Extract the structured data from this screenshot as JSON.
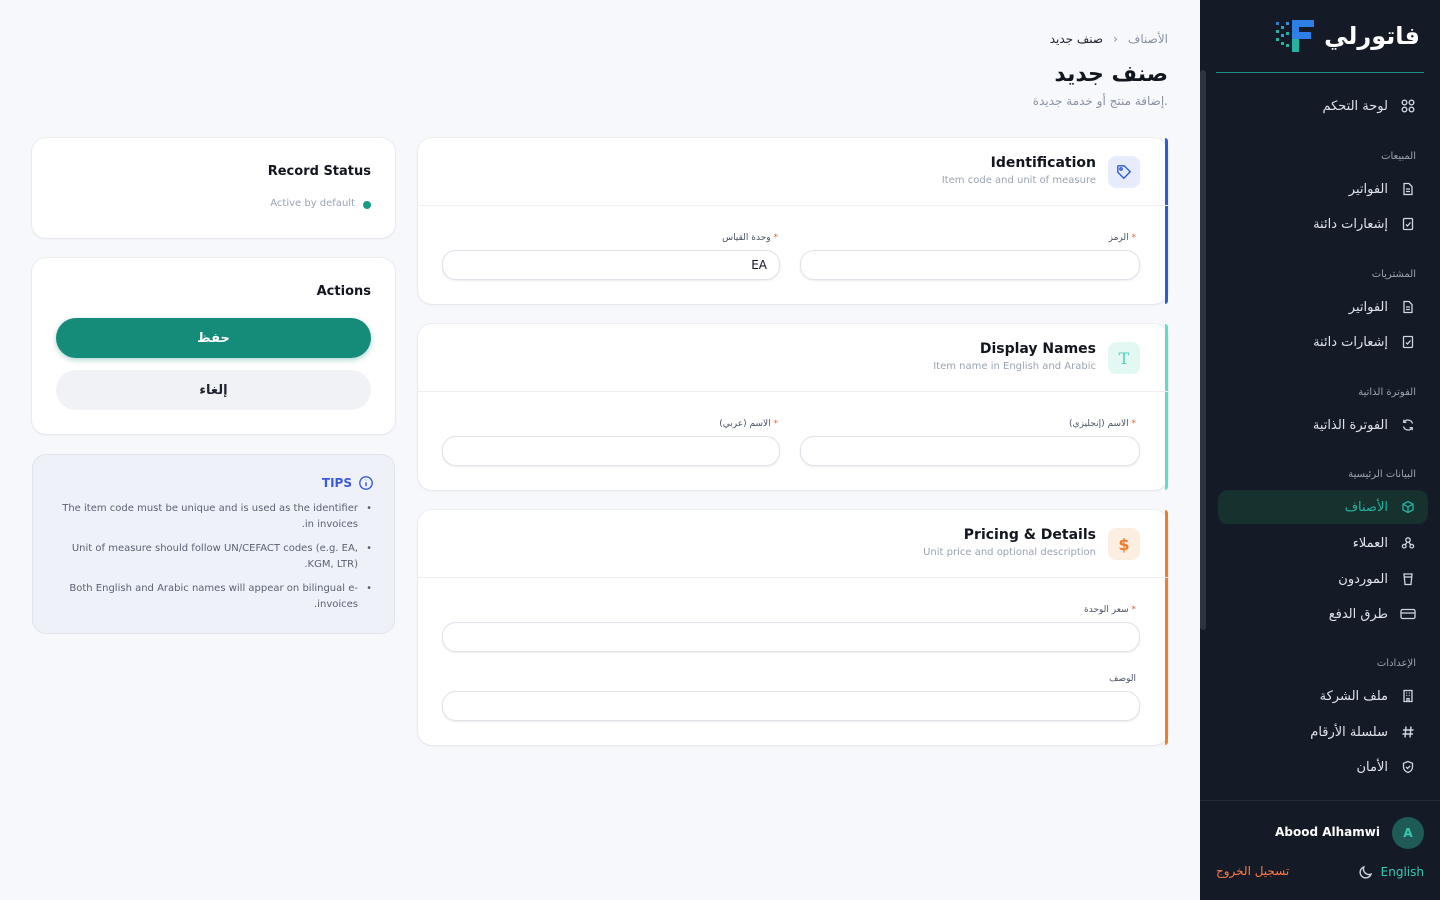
{
  "app": {
    "logo_text": "فاتورلي"
  },
  "breadcrumb": {
    "parent": "الأصناف",
    "separator": "›",
    "current": "صنف جديد"
  },
  "page": {
    "title": "صنف جديد",
    "subtitle": "إضافة منتج أو خدمة جديدة."
  },
  "sidebar": {
    "dashboard": "لوحة التحكم",
    "sections": {
      "sales": "المبيعات",
      "purchases": "المشتريات",
      "self_billing": "الفوترة الذاتية",
      "master_data": "البيانات الرئيسية",
      "settings": "الإعدادات"
    },
    "sales_invoices": "الفواتير",
    "sales_credit_notes": "إشعارات دائنة",
    "purchase_invoices": "الفواتير",
    "purchase_credit_notes": "إشعارات دائنة",
    "self_billing_item": "الفوترة الذاتية",
    "items": "الأصناف",
    "customers": "العملاء",
    "suppliers": "الموردون",
    "payment_methods": "طرق الدفع",
    "company_profile": "ملف الشركة",
    "number_series": "سلسلة الأرقام",
    "security": "الأمان"
  },
  "user": {
    "name": "Abood Alhamwi",
    "initial": "A",
    "language": "English",
    "logout": "تسجيل الخروج"
  },
  "identification": {
    "title": "Identification",
    "subtitle": "Item code and unit of measure",
    "code_label": "الرمز",
    "uom_label": "وحدة القياس",
    "code_value": "",
    "uom_value": "EA"
  },
  "display_names": {
    "title": "Display Names",
    "subtitle": "Item name in English and Arabic",
    "icon_glyph": "T",
    "name_en_label": "الاسم (إنجليزي)",
    "name_ar_label": "الاسم (عربي)",
    "name_en_value": "",
    "name_ar_value": ""
  },
  "pricing": {
    "title": "Pricing & Details",
    "subtitle": "Unit price and optional description",
    "icon_glyph": "$",
    "unit_price_label": "سعر الوحدة",
    "description_label": "الوصف",
    "unit_price_value": "",
    "description_value": ""
  },
  "required_marker": "*",
  "record_status": {
    "title": "Record Status",
    "status_text": "Active by default"
  },
  "actions": {
    "title": "Actions",
    "save_label": "حفظ",
    "cancel_label": "إلغاء"
  },
  "tips": {
    "title": "TIPS",
    "items": [
      "The item code must be unique and is used as the identifier in invoices.",
      "Unit of measure should follow UN/CEFACT codes (e.g. EA, KGM, LTR).",
      "Both English and Arabic names will appear on bilingual e-invoices."
    ]
  },
  "colors": {
    "sidebar_bg": "#141b26",
    "brand_teal": "#158b7a",
    "active_teal": "#24b39e",
    "identification_accent": "#2f5bd6",
    "display_names_accent": "#5fdcc8",
    "pricing_accent": "#f57a2a",
    "logout": "#ff7a45",
    "tips_accent": "#3a5ad9"
  }
}
